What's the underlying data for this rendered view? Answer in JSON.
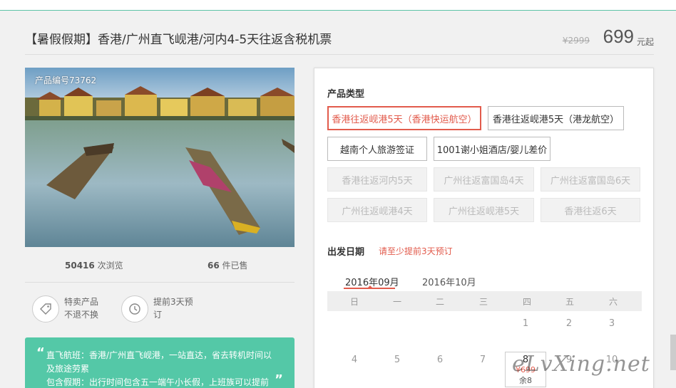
{
  "product": {
    "title": "【暑假假期】香港/广州直飞岘港/河内4-5天往返含税机票",
    "price_original": "¥2999",
    "price_now": "699",
    "price_unit": "元起",
    "product_no": "产品编号73762"
  },
  "stats": {
    "views_count": "50416",
    "views_label": "次浏览",
    "sold_count": "66",
    "sold_label": "件已售"
  },
  "features": [
    {
      "line1": "特卖产品",
      "line2": "不退不换",
      "icon": "tag-icon"
    },
    {
      "line1": "提前3天预",
      "line2": "订",
      "icon": "history-icon"
    }
  ],
  "highlights": {
    "line1": "直飞航班：香港/广州直飞岘港，一站直达，省去转机时间以",
    "line2": "及旅途劳累",
    "line3": "包含假期：出行时间包含五一端午小长假，上班族可以提前"
  },
  "panel": {
    "type_label": "产品类型",
    "options": [
      {
        "label": "香港往返岘港5天（香港快运航空）",
        "state": "selected"
      },
      {
        "label": "香港往返岘港5天（港龙航空）",
        "state": "normal"
      },
      {
        "label": "越南个人旅游签证",
        "state": "normal"
      },
      {
        "label": "1001谢小姐酒店/婴儿差价",
        "state": "normal"
      },
      {
        "label": "香港往返河内5天",
        "state": "disabled"
      },
      {
        "label": "广州往返富国岛4天",
        "state": "disabled"
      },
      {
        "label": "广州往返富国岛6天",
        "state": "disabled"
      },
      {
        "label": "广州往返岘港4天",
        "state": "disabled"
      },
      {
        "label": "广州往返岘港5天",
        "state": "disabled"
      },
      {
        "label": "香港往返6天",
        "state": "disabled"
      }
    ],
    "date_label": "出发日期",
    "date_hint": "请至少提前3天预订",
    "months": [
      "2016年09月",
      "2016年10月"
    ],
    "weekdays": [
      "日",
      "一",
      "二",
      "三",
      "四",
      "五",
      "六"
    ],
    "row1": [
      "1",
      "2",
      "3"
    ],
    "row2": [
      "4",
      "5",
      "6",
      "7",
      "8",
      "9",
      "10"
    ],
    "selected_day": {
      "day": "8",
      "price": "¥699",
      "remain": "余8"
    }
  },
  "watermark": "eLvXing.net",
  "colors": {
    "accent": "#e25b4c",
    "green": "#54c8a7"
  }
}
